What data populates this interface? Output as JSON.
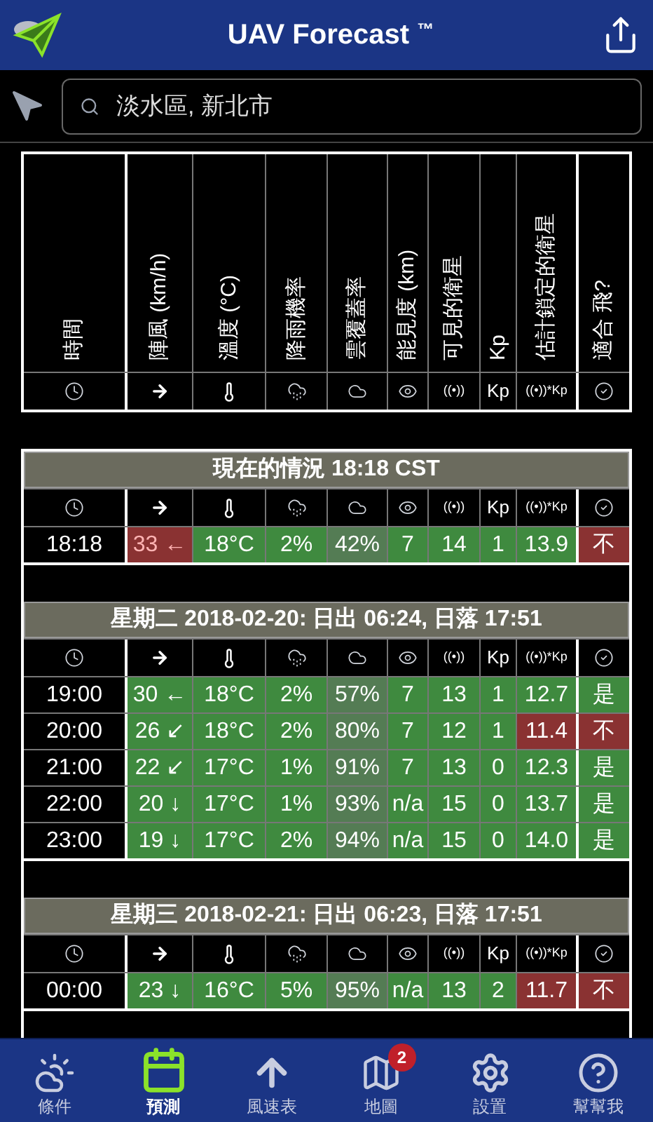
{
  "header": {
    "title": "UAV Forecast",
    "trademark": "™"
  },
  "search": {
    "value": "淡水區, 新北市"
  },
  "columns": [
    {
      "label": "時間",
      "kind": "clock"
    },
    {
      "label": "陣風 (km/h)",
      "kind": "arrow"
    },
    {
      "label": "溫度 (°C)",
      "kind": "thermometer"
    },
    {
      "label": "降雨機率",
      "kind": "rain"
    },
    {
      "label": "雲覆蓋率",
      "kind": "cloud"
    },
    {
      "label": "能見度 (km)",
      "kind": "eye"
    },
    {
      "label": "可見的衛星",
      "icon_text": "((•))"
    },
    {
      "label": "Kp",
      "icon_text": "Kp"
    },
    {
      "label": "估計鎖定的衛星",
      "icon_text": "((•))*Kp"
    },
    {
      "label": "適合 飛?",
      "kind": "check"
    }
  ],
  "sections": [
    {
      "title": "現在的情況 18:18 CST",
      "icon_texts": [
        "((•))",
        "Kp",
        "((•))*Kp"
      ],
      "rows": [
        {
          "time": "18:18",
          "cells": [
            {
              "text": "33 ←",
              "color": "#8a3232"
            },
            {
              "text": "18°C",
              "color": "#3f8a3f"
            },
            {
              "text": "2%",
              "color": "#3f8a3f"
            },
            {
              "text": "42%",
              "color": "#547c54"
            },
            {
              "text": "7",
              "color": "#3f8a3f"
            },
            {
              "text": "14",
              "color": "#3f8a3f"
            },
            {
              "text": "1",
              "color": "#3f8a3f"
            },
            {
              "text": "13.9",
              "color": "#3f8a3f"
            },
            {
              "text": "不",
              "color": "#8a3232"
            }
          ]
        }
      ]
    },
    {
      "title": "星期二 2018-02-20: 日出 06:24, 日落 17:51",
      "icon_texts": [
        "((•))",
        "Kp",
        "((•))*Kp"
      ],
      "rows": [
        {
          "time": "19:00",
          "cells": [
            {
              "text": "30 ←",
              "color": "#3f8a3f"
            },
            {
              "text": "18°C",
              "color": "#3f8a3f"
            },
            {
              "text": "2%",
              "color": "#3f8a3f"
            },
            {
              "text": "57%",
              "color": "#547c54"
            },
            {
              "text": "7",
              "color": "#3f8a3f"
            },
            {
              "text": "13",
              "color": "#3f8a3f"
            },
            {
              "text": "1",
              "color": "#3f8a3f"
            },
            {
              "text": "12.7",
              "color": "#3f8a3f"
            },
            {
              "text": "是",
              "color": "#3f8a3f"
            }
          ]
        },
        {
          "time": "20:00",
          "cells": [
            {
              "text": "26 ↙",
              "color": "#3f8a3f"
            },
            {
              "text": "18°C",
              "color": "#3f8a3f"
            },
            {
              "text": "2%",
              "color": "#3f8a3f"
            },
            {
              "text": "80%",
              "color": "#547c54"
            },
            {
              "text": "7",
              "color": "#3f8a3f"
            },
            {
              "text": "12",
              "color": "#3f8a3f"
            },
            {
              "text": "1",
              "color": "#3f8a3f"
            },
            {
              "text": "11.4",
              "color": "#8a3232"
            },
            {
              "text": "不",
              "color": "#8a3232"
            }
          ]
        },
        {
          "time": "21:00",
          "cells": [
            {
              "text": "22 ↙",
              "color": "#3f8a3f"
            },
            {
              "text": "17°C",
              "color": "#3f8a3f"
            },
            {
              "text": "1%",
              "color": "#3f8a3f"
            },
            {
              "text": "91%",
              "color": "#547c54"
            },
            {
              "text": "7",
              "color": "#3f8a3f"
            },
            {
              "text": "13",
              "color": "#3f8a3f"
            },
            {
              "text": "0",
              "color": "#3f8a3f"
            },
            {
              "text": "12.3",
              "color": "#3f8a3f"
            },
            {
              "text": "是",
              "color": "#3f8a3f"
            }
          ]
        },
        {
          "time": "22:00",
          "cells": [
            {
              "text": "20 ↓",
              "color": "#3f8a3f"
            },
            {
              "text": "17°C",
              "color": "#3f8a3f"
            },
            {
              "text": "1%",
              "color": "#3f8a3f"
            },
            {
              "text": "93%",
              "color": "#547c54"
            },
            {
              "text": "n/a",
              "color": "#3f8a3f"
            },
            {
              "text": "15",
              "color": "#3f8a3f"
            },
            {
              "text": "0",
              "color": "#3f8a3f"
            },
            {
              "text": "13.7",
              "color": "#3f8a3f"
            },
            {
              "text": "是",
              "color": "#3f8a3f"
            }
          ]
        },
        {
          "time": "23:00",
          "cells": [
            {
              "text": "19 ↓",
              "color": "#3f8a3f"
            },
            {
              "text": "17°C",
              "color": "#3f8a3f"
            },
            {
              "text": "2%",
              "color": "#3f8a3f"
            },
            {
              "text": "94%",
              "color": "#547c54"
            },
            {
              "text": "n/a",
              "color": "#3f8a3f"
            },
            {
              "text": "15",
              "color": "#3f8a3f"
            },
            {
              "text": "0",
              "color": "#3f8a3f"
            },
            {
              "text": "14.0",
              "color": "#3f8a3f"
            },
            {
              "text": "是",
              "color": "#3f8a3f"
            }
          ]
        }
      ]
    },
    {
      "title": "星期三 2018-02-21: 日出 06:23, 日落 17:51",
      "icon_texts": [
        "((•))",
        "Kp",
        "((•))*Kp"
      ],
      "rows": [
        {
          "time": "00:00",
          "cells": [
            {
              "text": "23 ↓",
              "color": "#3f8a3f"
            },
            {
              "text": "16°C",
              "color": "#3f8a3f"
            },
            {
              "text": "5%",
              "color": "#3f8a3f"
            },
            {
              "text": "95%",
              "color": "#547c54"
            },
            {
              "text": "n/a",
              "color": "#3f8a3f"
            },
            {
              "text": "13",
              "color": "#3f8a3f"
            },
            {
              "text": "2",
              "color": "#3f8a3f"
            },
            {
              "text": "11.7",
              "color": "#8a3232"
            },
            {
              "text": "不",
              "color": "#8a3232"
            }
          ]
        }
      ]
    }
  ],
  "tabs": [
    {
      "label": "條件",
      "kind": "sun-cloud",
      "selected": false
    },
    {
      "label": "預測",
      "kind": "calendar",
      "selected": true
    },
    {
      "label": "風速表",
      "kind": "arrow-up",
      "selected": false
    },
    {
      "label": "地圖",
      "kind": "map",
      "selected": false,
      "badge": "2"
    },
    {
      "label": "設置",
      "kind": "gear",
      "selected": false
    },
    {
      "label": "幫幫我",
      "kind": "question",
      "selected": false
    }
  ]
}
